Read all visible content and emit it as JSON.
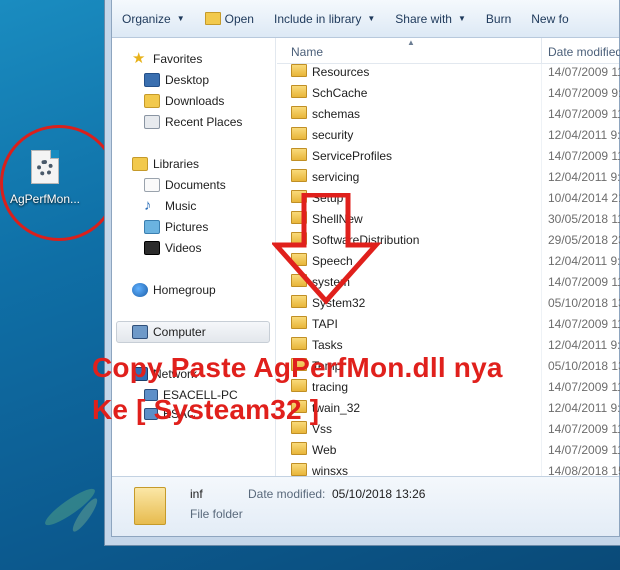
{
  "desktop": {
    "icon_label": "AgPerfMon..."
  },
  "toolbar": {
    "organize": "Organize",
    "open": "Open",
    "include": "Include in library",
    "share": "Share with",
    "burn": "Burn",
    "newf": "New fo"
  },
  "nav": {
    "favorites": "Favorites",
    "desktop": "Desktop",
    "downloads": "Downloads",
    "recent": "Recent Places",
    "libraries": "Libraries",
    "documents": "Documents",
    "music": "Music",
    "pictures": "Pictures",
    "videos": "Videos",
    "homegroup": "Homegroup",
    "computer": "Computer",
    "network": "Network",
    "pc1": "ESACELL-PC",
    "pc2": "ESAC"
  },
  "columns": {
    "name": "Name",
    "date": "Date modified"
  },
  "files": [
    {
      "name": "Resources",
      "date": "14/07/2009 11:"
    },
    {
      "name": "SchCache",
      "date": "14/07/2009 9:"
    },
    {
      "name": "schemas",
      "date": "14/07/2009 11:"
    },
    {
      "name": "security",
      "date": "12/04/2011 9:"
    },
    {
      "name": "ServiceProfiles",
      "date": "14/07/2009 11:"
    },
    {
      "name": "servicing",
      "date": "12/04/2011 9:"
    },
    {
      "name": "Setup",
      "date": "10/04/2014 21"
    },
    {
      "name": "ShellNew",
      "date": "30/05/2018 11:"
    },
    {
      "name": "SoftwareDistribution",
      "date": "29/05/2018 23"
    },
    {
      "name": "Speech",
      "date": "12/04/2011 9:"
    },
    {
      "name": "system",
      "date": "14/07/2009 11:"
    },
    {
      "name": "System32",
      "date": "05/10/2018 13"
    },
    {
      "name": "TAPI",
      "date": "14/07/2009 11:"
    },
    {
      "name": "Tasks",
      "date": "12/04/2011 9:"
    },
    {
      "name": "Temp",
      "date": "05/10/2018 13"
    },
    {
      "name": "tracing",
      "date": "14/07/2009 11:"
    },
    {
      "name": "twain_32",
      "date": "12/04/2011 9:"
    },
    {
      "name": "Vss",
      "date": "14/07/2009 11:"
    },
    {
      "name": "Web",
      "date": "14/07/2009 11:"
    },
    {
      "name": "winsxs",
      "date": "14/08/2018 15"
    }
  ],
  "details": {
    "name": "inf",
    "type": "File folder",
    "modified_label": "Date modified:",
    "modified_value": "05/10/2018 13:26"
  },
  "annotation": {
    "line1": "Copy Paste AgPerfMon.dll nya",
    "line2": "Ke [ Systeam32 ]",
    "color": "#e0201c"
  }
}
